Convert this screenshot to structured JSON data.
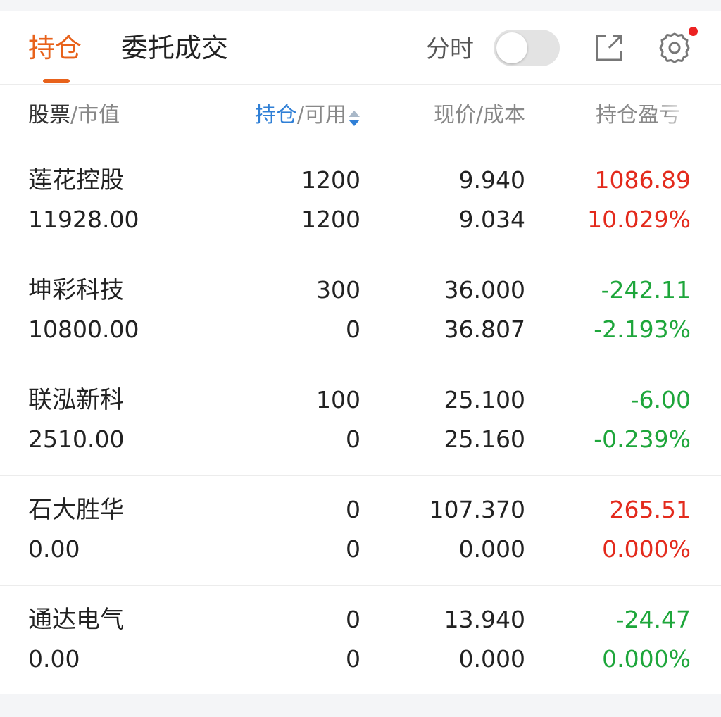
{
  "tabs": {
    "holdings": "持仓",
    "orders": "委托成交"
  },
  "header": {
    "intraday_label": "分时",
    "intraday_on": false
  },
  "colors": {
    "accent": "#e8621b",
    "sort_blue": "#2f7fd6",
    "gain_red": "#e32a1c",
    "loss_green": "#1ea63b"
  },
  "columns": {
    "stock": "股票",
    "market_value": "市值",
    "position": "持仓",
    "available": "可用",
    "price": "现价",
    "cost": "成本",
    "pl": "持仓盈亏",
    "separator": "/"
  },
  "holdings": [
    {
      "name": "莲花控股",
      "market_value": "11928.00",
      "position": "1200",
      "available": "1200",
      "price": "9.940",
      "cost": "9.034",
      "pl": "1086.89",
      "pl_pct": "10.029%",
      "trend": "up"
    },
    {
      "name": "坤彩科技",
      "market_value": "10800.00",
      "position": "300",
      "available": "0",
      "price": "36.000",
      "cost": "36.807",
      "pl": "-242.11",
      "pl_pct": "-2.193%",
      "trend": "down"
    },
    {
      "name": "联泓新科",
      "market_value": "2510.00",
      "position": "100",
      "available": "0",
      "price": "25.100",
      "cost": "25.160",
      "pl": "-6.00",
      "pl_pct": "-0.239%",
      "trend": "down"
    },
    {
      "name": "石大胜华",
      "market_value": "0.00",
      "position": "0",
      "available": "0",
      "price": "107.370",
      "cost": "0.000",
      "pl": "265.51",
      "pl_pct": "0.000%",
      "trend": "up"
    },
    {
      "name": "通达电气",
      "market_value": "0.00",
      "position": "0",
      "available": "0",
      "price": "13.940",
      "cost": "0.000",
      "pl": "-24.47",
      "pl_pct": "0.000%",
      "trend": "down"
    }
  ]
}
